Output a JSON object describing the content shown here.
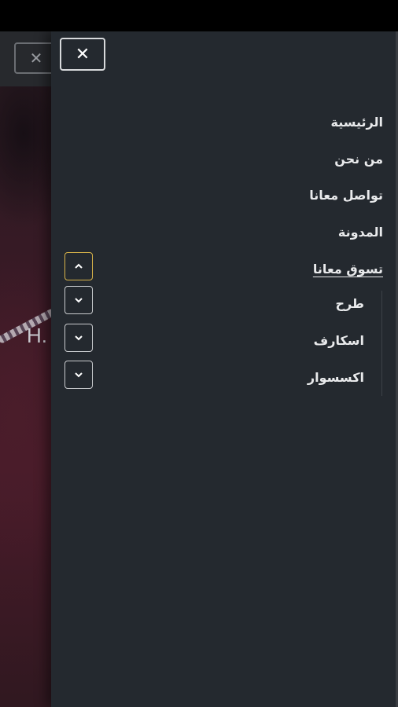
{
  "background": {
    "hero_text": "H.",
    "close_icon": "close-icon"
  },
  "drawer": {
    "close_icon": "close-icon",
    "close_glyph": "✕",
    "menu_items": [
      {
        "label": "الرئيسية"
      },
      {
        "label": "من نحن"
      },
      {
        "label": "تواصل معانا"
      },
      {
        "label": "المدونة"
      },
      {
        "label": "تسوق معانا",
        "active": true,
        "expanded": true
      }
    ],
    "submenu_items": [
      {
        "label": "طرح"
      },
      {
        "label": "اسكارف"
      },
      {
        "label": "اكسسوار"
      }
    ],
    "toggle_icons": [
      "chevron-up-icon",
      "chevron-down-icon",
      "chevron-down-icon",
      "chevron-down-icon"
    ]
  },
  "colors": {
    "drawer_bg": "#24292f",
    "accent_focus": "#d9b44a",
    "text": "#e9eaec"
  }
}
